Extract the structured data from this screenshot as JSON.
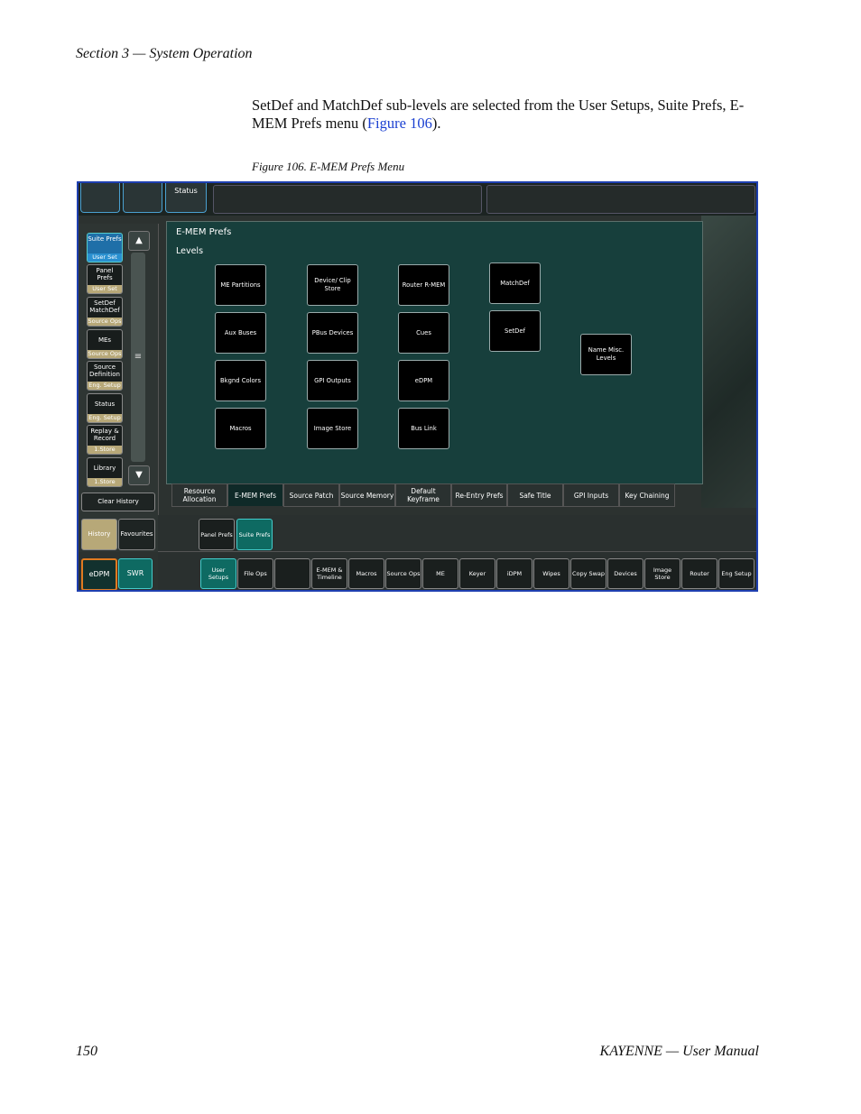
{
  "header": "Section 3 — System Operation",
  "intro": {
    "before": "SetDef and MatchDef sub-levels are selected from the User Setups, Suite Prefs, E-MEM Prefs menu (",
    "link": "Figure 106",
    "after": ")."
  },
  "caption": "Figure 106.  E-MEM Prefs Menu",
  "screenshot": {
    "top_status": "Status",
    "side_buttons": [
      {
        "label": "Suite Prefs",
        "sub": "User Set",
        "selected": true
      },
      {
        "label": "Panel Prefs",
        "sub": "User Set"
      },
      {
        "label": "SetDef MatchDef",
        "sub": "Source Ops"
      },
      {
        "label": "MEs",
        "sub": "Source Ops"
      },
      {
        "label": "Source Definition",
        "sub": "Eng. Setup"
      },
      {
        "label": "Status",
        "sub": "Eng. Setup"
      },
      {
        "label": "Replay & Record",
        "sub": "1.Store"
      },
      {
        "label": "Library",
        "sub": "1.Store"
      }
    ],
    "clear_history": "Clear History",
    "history": "History",
    "favourites": "Favourites",
    "edpm": "eDPM",
    "swr": "SWR",
    "panel_title": "E-MEM Prefs",
    "panel_subtitle": "Levels",
    "levels": [
      "ME Partitions",
      "Device/ Clip Store",
      "Router R-MEM",
      "MatchDef",
      "Aux Buses",
      "PBus Devices",
      "Cues",
      "SetDef",
      "Bkgnd Colors",
      "GPI Outputs",
      "eDPM",
      "Name Misc. Levels",
      "Macros",
      "Image Store",
      "Bus Link"
    ],
    "tabs": [
      "Resource Allocation",
      "E-MEM Prefs",
      "Source Patch",
      "Source Memory",
      "Default Keyframe",
      "Re-Entry Prefs",
      "Safe Title",
      "GPI Inputs",
      "Key Chaining"
    ],
    "sub_tabs": [
      "Panel Prefs",
      "Suite Prefs"
    ],
    "nav": [
      "User Setups",
      "File Ops",
      "",
      "E-MEM & Timeline",
      "Macros",
      "Source Ops",
      "ME",
      "Keyer",
      "iDPM",
      "Wipes",
      "Copy Swap",
      "Devices",
      "Image Store",
      "Router",
      "Eng Setup"
    ]
  },
  "footer": {
    "page": "150",
    "title": "KAYENNE  —  User Manual"
  }
}
